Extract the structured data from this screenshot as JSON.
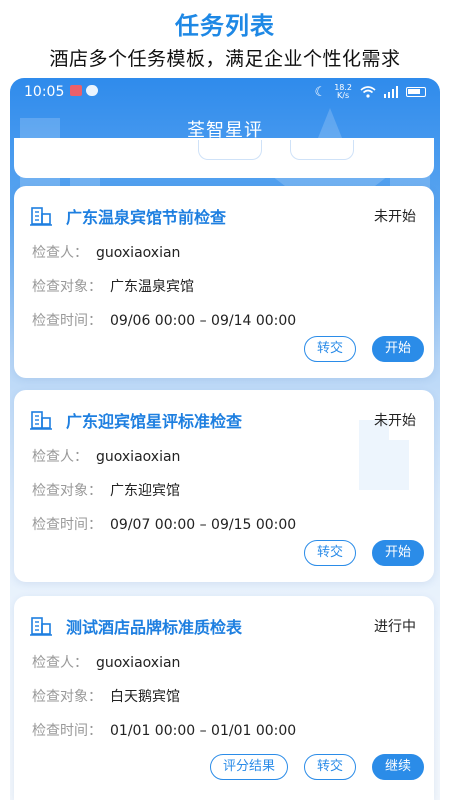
{
  "promo": {
    "title": "任务列表",
    "subtitle": "酒店多个任务模板，满足企业个性化需求"
  },
  "status_bar": {
    "time": "10:05",
    "network_speed_value": "18.2",
    "network_speed_unit": "K/s"
  },
  "navbar": {
    "title": "荃智星评"
  },
  "labels": {
    "inspector": "检查人：",
    "target": "检查对象：",
    "time": "检查时间："
  },
  "tasks": [
    {
      "title": "广东温泉宾馆节前检查",
      "status": "未开始",
      "inspector": "guoxiaoxian",
      "target": "广东温泉宾馆",
      "time": "09/06 00:00 – 09/14 00:00",
      "buttons": [
        "转交",
        "开始"
      ]
    },
    {
      "title": "广东迎宾馆星评标准检查",
      "status": "未开始",
      "inspector": "guoxiaoxian",
      "target": "广东迎宾馆",
      "time": "09/07 00:00 – 09/15 00:00",
      "buttons": [
        "转交",
        "开始"
      ]
    },
    {
      "title": "测试酒店品牌标准质检表",
      "status": "进行中",
      "inspector": "guoxiaoxian",
      "target": "白天鹅宾馆",
      "time": "01/01 00:00 – 01/01 00:00",
      "buttons": [
        "评分结果",
        "转交",
        "继续"
      ]
    }
  ],
  "colors": {
    "accent": "#2b8ce8",
    "title_blue": "#1e7fe0",
    "header_blue": "#2f8bec"
  }
}
